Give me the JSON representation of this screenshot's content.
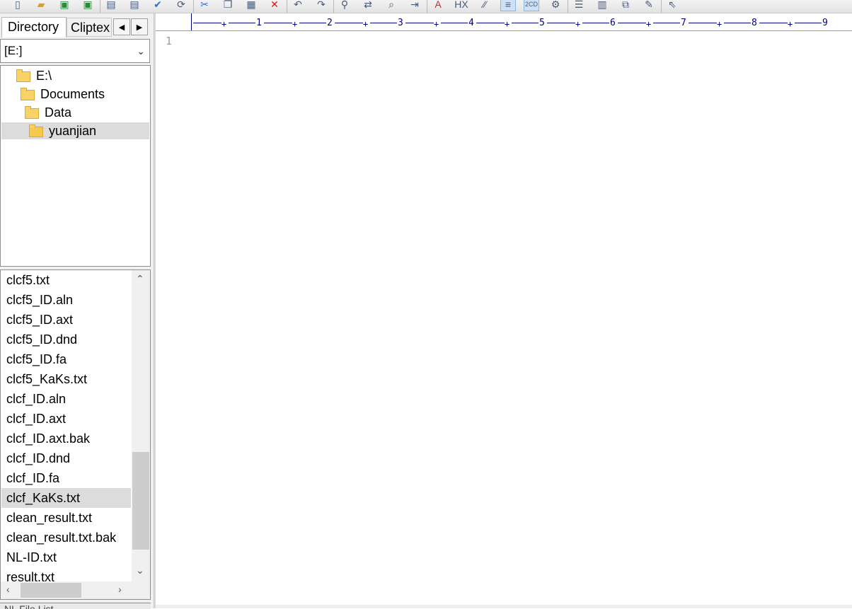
{
  "toolbar": {
    "icons": [
      "new-file-icon",
      "open-folder-icon",
      "save-icon",
      "save-all-icon",
      "print-preview-icon",
      "print-icon",
      "spell-check-icon",
      "convert-icon",
      "cut-icon",
      "copy-icon",
      "paste-icon",
      "delete-icon",
      "undo-icon",
      "redo-icon",
      "find-icon",
      "replace-icon",
      "find-in-files-icon",
      "goto-icon",
      "font-icon",
      "hex-icon",
      "word-wrap-icon",
      "column-mode-icon",
      "ascii-mode-icon",
      "settings-icon",
      "list-lines-icon",
      "column-markers-icon",
      "compare-icon",
      "script-icon",
      "help-icon"
    ],
    "hex_label": "HX",
    "ascii_label": "2CD"
  },
  "left_panel": {
    "tabs": [
      {
        "label": "Directory",
        "active": true
      },
      {
        "label": "Cliptex",
        "active": false
      }
    ],
    "drive": "[E:]",
    "tree": [
      {
        "label": "E:\\",
        "level": 0,
        "selected": false
      },
      {
        "label": "Documents",
        "level": 1,
        "selected": false
      },
      {
        "label": "Data",
        "level": 2,
        "selected": false
      },
      {
        "label": "yuanjian",
        "level": 3,
        "selected": true
      }
    ],
    "files": [
      {
        "label": "clcf5.txt"
      },
      {
        "label": "clcf5_ID.aln"
      },
      {
        "label": "clcf5_ID.axt"
      },
      {
        "label": "clcf5_ID.dnd"
      },
      {
        "label": "clcf5_ID.fa"
      },
      {
        "label": "clcf5_KaKs.txt"
      },
      {
        "label": "clcf_ID.aln"
      },
      {
        "label": "clcf_ID.axt"
      },
      {
        "label": "clcf_ID.axt.bak"
      },
      {
        "label": "clcf_ID.dnd"
      },
      {
        "label": "clcf_ID.fa"
      },
      {
        "label": "clcf_KaKs.txt",
        "selected": true
      },
      {
        "label": "clean_result.txt"
      },
      {
        "label": "clean_result.txt.bak"
      },
      {
        "label": "NL-ID.txt"
      },
      {
        "label": "result.txt"
      }
    ],
    "bottom_strip": "NL File List"
  },
  "editor": {
    "ruler_numbers": [
      "1",
      "2",
      "3",
      "4",
      "5",
      "6",
      "7",
      "8",
      "9"
    ],
    "line_numbers": [
      "1"
    ]
  },
  "colors": {
    "ruler": "#000080",
    "selection": "#dcdcdc",
    "folder": "#f8d36a"
  }
}
